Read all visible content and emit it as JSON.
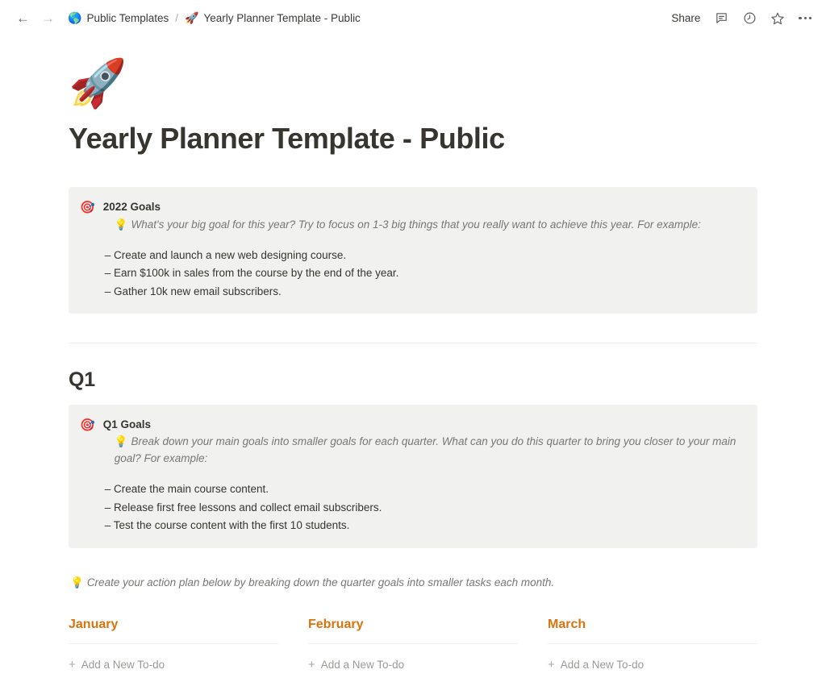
{
  "topbar": {
    "back_icon": "arrow-left-icon",
    "forward_icon": "arrow-right-icon",
    "breadcrumb": {
      "parent_emoji": "🌎",
      "parent_label": "Public Templates",
      "separator": "/",
      "current_emoji": "🚀",
      "current_label": "Yearly Planner Template - Public"
    },
    "share_label": "Share",
    "comment_icon": "comment-icon",
    "history_icon": "clock-icon",
    "favorite_icon": "star-icon",
    "more_icon": "more-options-icon"
  },
  "page": {
    "icon": "🚀",
    "title": "Yearly Planner Template - Public"
  },
  "year_callout": {
    "emoji": "🎯",
    "title": "2022 Goals",
    "hint_bulb": "💡",
    "hint": "What's your big goal for this year? Try to focus on 1-3 big things that you really want to achieve this year. For example:",
    "items": [
      "– Create and launch a new web designing course.",
      "– Earn $100k in sales from the course by the end of the year.",
      "– Gather 10k new email subscribers."
    ]
  },
  "quarter": {
    "heading": "Q1",
    "callout": {
      "emoji": "🎯",
      "title": "Q1 Goals",
      "hint_bulb": "💡",
      "hint": "Break down your main goals into smaller goals for each quarter. What can you do this quarter to bring you closer to your main goal? For example:",
      "items": [
        "– Create the main course content.",
        "– Release first free lessons and collect email subscribers.",
        "– Test the course content with the first 10 students."
      ]
    },
    "action_hint_bulb": "💡",
    "action_hint": "Create your action plan below by breaking down the quarter goals into smaller tasks each month.",
    "months": [
      {
        "name": "January",
        "add_label": "Add a New To-do"
      },
      {
        "name": "February",
        "add_label": "Add a New To-do"
      },
      {
        "name": "March",
        "add_label": "Add a New To-do"
      }
    ]
  },
  "colors": {
    "accent_orange": "#d9730d",
    "callout_bg": "#f1f1ef",
    "text": "#37352f",
    "muted": "#787774"
  }
}
